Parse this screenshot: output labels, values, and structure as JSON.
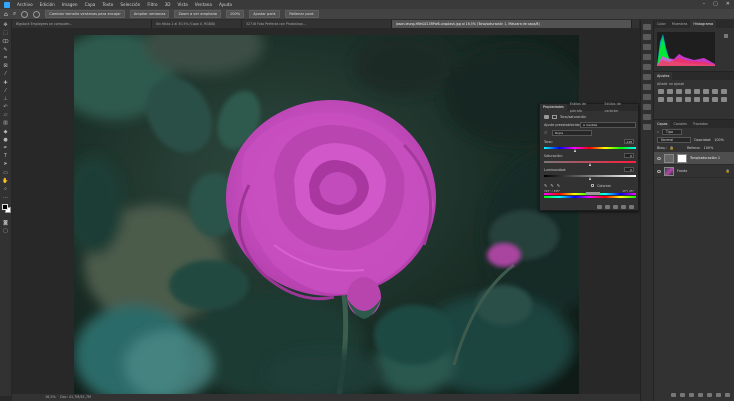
{
  "menu": {
    "items": [
      "Archivo",
      "Edición",
      "Imagen",
      "Capa",
      "Texto",
      "Selección",
      "Filtro",
      "3D",
      "Vista",
      "Ventana",
      "Ayuda"
    ]
  },
  "options": {
    "buttons": [
      "Cambiar tamaño ventanas para encajar",
      "Ampliar ventanas",
      "Zoom a ver ampliado",
      "100%",
      "Ajustar pant.",
      "Rellenar pant."
    ]
  },
  "tabs": [
    "Bigstock Employees on computer...",
    "Sin título-1 al 30.5% (Capa 0, RGB/8)",
    "32716 Foto Perfecta con Photoshop...",
    "jason-leung-HNh0Z1SRPw8-unsplash.jpg al 16,5% (Tono/saturación 1, Máscara de capa/8)"
  ],
  "right": {
    "top_tabs": [
      "Color",
      "Muestras",
      "Histograma"
    ],
    "adjust_tabs": [
      "Ajustes"
    ],
    "adjust_label": "Añadir un ajuste",
    "layer_tabs": [
      "Capas",
      "Canales",
      "Trazados"
    ],
    "search_label": "Tipo",
    "blend_mode": "Normal",
    "opacity_label": "Opacidad:",
    "opacity_value": "100%",
    "lock_label": "Bloq.:",
    "fill_label": "Relleno:",
    "fill_value": "100%",
    "layers": [
      {
        "name": "Tono/saturación 1",
        "selected": true
      },
      {
        "name": "Fondo",
        "selected": false
      }
    ]
  },
  "properties": {
    "tabs": [
      "Propiedades",
      "Estilos de párrafo",
      "Estilos de carácter"
    ],
    "title": "Tono/saturación",
    "preset_label": "Ajuste preestablecido:",
    "preset_value": "A medida",
    "channel": "Rojos",
    "hue_label": "Tono:",
    "hue_value": "-148",
    "sat_label": "Saturación:",
    "sat_value": "0",
    "light_label": "Luminosidad:",
    "light_value": "0",
    "colorize_label": "Colorear",
    "range_left": "315° / 345°",
    "range_right": "15°\\ 45°"
  },
  "status": {
    "zoom": "16,5%",
    "doc": "Doc: 41,7M/41,7M"
  },
  "colors": {
    "accent": "#31a8ff",
    "rose": "#c74fc0",
    "bg": "#282828"
  }
}
